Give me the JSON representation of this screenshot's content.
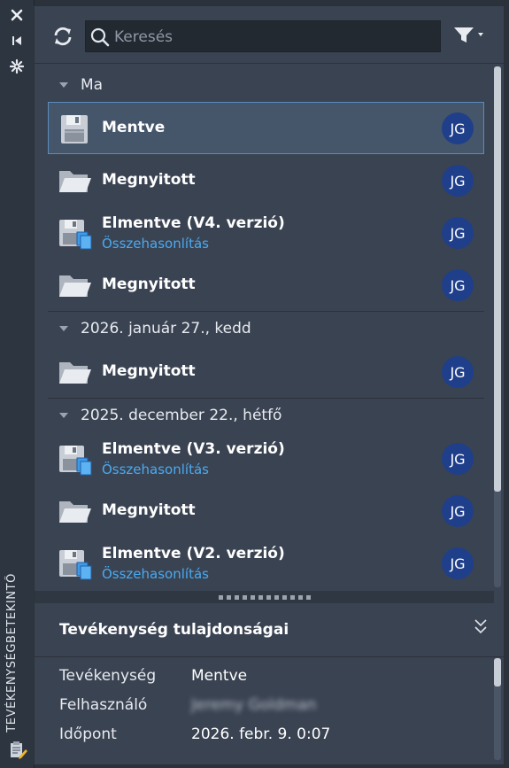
{
  "side": {
    "vertical_title": "TEVÉKENYSÉGBETEKINTŐ"
  },
  "toolbar": {
    "search_placeholder": "Keresés"
  },
  "groups": [
    {
      "label": "Ma",
      "items": [
        {
          "type": "saved",
          "title": "Mentve",
          "link": "",
          "user": "JG",
          "selected": true
        },
        {
          "type": "opened",
          "title": "Megnyitott",
          "link": "",
          "user": "JG"
        },
        {
          "type": "saved-version",
          "title": "Elmentve (V4. verzió)",
          "link": "Összehasonlítás",
          "user": "JG"
        },
        {
          "type": "opened",
          "title": "Megnyitott",
          "link": "",
          "user": "JG"
        }
      ]
    },
    {
      "label": "2026. január 27., kedd",
      "items": [
        {
          "type": "opened",
          "title": "Megnyitott",
          "link": "",
          "user": "JG"
        }
      ]
    },
    {
      "label": "2025. december 22., hétfő",
      "items": [
        {
          "type": "saved-version",
          "title": "Elmentve (V3. verzió)",
          "link": "Összehasonlítás",
          "user": "JG"
        },
        {
          "type": "opened",
          "title": "Megnyitott",
          "link": "",
          "user": "JG"
        },
        {
          "type": "saved-version",
          "title": "Elmentve (V2. verzió)",
          "link": "Összehasonlítás",
          "user": "JG"
        }
      ]
    }
  ],
  "properties": {
    "title": "Tevékenység tulajdonságai",
    "rows": [
      {
        "key": "Tevékenység",
        "value": "Mentve"
      },
      {
        "key": "Felhasználó",
        "value": "Jeremy Goldman"
      },
      {
        "key": "Időpont",
        "value": "2026. febr. 9. 0:07"
      }
    ]
  },
  "colors": {
    "accent_link": "#4aaaf0",
    "avatar_bg": "#1f3f8a",
    "selected_bg": "#45566a",
    "selected_border": "#5b8bbd"
  }
}
